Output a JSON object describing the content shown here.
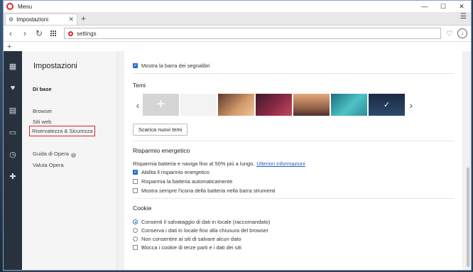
{
  "window": {
    "title": "Menu"
  },
  "tab": {
    "label": "Impostazioni"
  },
  "address": {
    "url": "settings"
  },
  "sidebar": {
    "title": "Impostazioni",
    "items": [
      {
        "label": "Di base"
      },
      {
        "label": "Browser"
      },
      {
        "label": "Siti web"
      },
      {
        "label": "Riservatezza & Sicurezza"
      },
      {
        "label": "Guida di Opera"
      },
      {
        "label": "Valuta Opera"
      }
    ]
  },
  "main": {
    "bookmarks_bar_label": "Mostra la barra dei segnalibri",
    "themes_title": "Temi",
    "themes_button": "Scarica nuovi temi",
    "energy": {
      "title": "Risparmio energetico",
      "description": "Risparmia batteria e naviga fino al 50% più a lungo.",
      "link": "Ulteriori informazioni",
      "options": [
        {
          "label": "Abilita il risparmio energetico",
          "checked": true
        },
        {
          "label": "Risparmia la batteria automaticamente",
          "checked": false
        },
        {
          "label": "Mostra sempre l'icona della batteria nella barra strumenti",
          "checked": false
        }
      ]
    },
    "cookies": {
      "title": "Cookie",
      "options": [
        {
          "label": "Consenti il salvataggio di dati in locale (raccomandato)",
          "selected": true
        },
        {
          "label": "Conserva i dati in locale fino alla chiusura del browser",
          "selected": false
        },
        {
          "label": "Non consentire ai siti di salvare alcun dato",
          "selected": false
        },
        {
          "label": "Blocca i cookie di terze parti e i dati dei siti",
          "selected": false,
          "checkbox": true
        }
      ]
    }
  }
}
